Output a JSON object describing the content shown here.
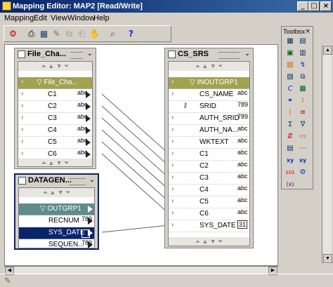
{
  "window": {
    "title": "Mapping Editor: MAP2 [Read/Write]"
  },
  "menu": [
    "Mapping",
    "Edit",
    "View",
    "Window",
    "Help"
  ],
  "toolbox": {
    "title": "Toolbox"
  },
  "tables": {
    "file": {
      "title": "File_Cha...",
      "group": "File_Cha...",
      "rows": [
        {
          "label": "C1",
          "type": "abc"
        },
        {
          "label": "C2",
          "type": "abc"
        },
        {
          "label": "C3",
          "type": "abc"
        },
        {
          "label": "C4",
          "type": "abc"
        },
        {
          "label": "C5",
          "type": "abc"
        },
        {
          "label": "C6",
          "type": "abc"
        }
      ]
    },
    "datagen": {
      "title": "DATAGEN...",
      "group": "OUTGRP1",
      "rows": [
        {
          "label": "RECNUM",
          "type": "789"
        },
        {
          "label": "SYS_DATE",
          "type": ""
        },
        {
          "label": "SEQUEN...",
          "type": "789"
        }
      ]
    },
    "cs": {
      "title": "CS_SRS",
      "group": "INOUTGRP1",
      "rows": [
        {
          "label": "CS_NAME",
          "type": "abc"
        },
        {
          "label": "SRID",
          "type": "789"
        },
        {
          "label": "AUTH_SRID",
          "type": "789"
        },
        {
          "label": "AUTH_NA...",
          "type": "abc"
        },
        {
          "label": "WKTEXT",
          "type": "abc"
        },
        {
          "label": "C1",
          "type": "abc"
        },
        {
          "label": "C2",
          "type": "abc"
        },
        {
          "label": "C3",
          "type": "abc"
        },
        {
          "label": "C4",
          "type": "abc"
        },
        {
          "label": "C5",
          "type": "abc"
        },
        {
          "label": "C6",
          "type": "abc"
        },
        {
          "label": "SYS_DATE",
          "type": "31"
        }
      ]
    }
  }
}
